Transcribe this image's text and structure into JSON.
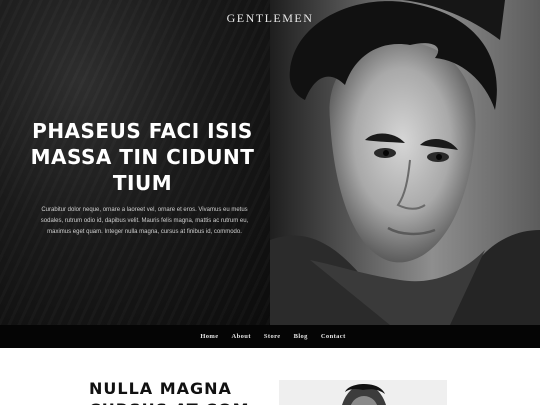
{
  "brand": {
    "name": "GENTLEMEN"
  },
  "hero": {
    "headline": "PHASEUS FACI ISIS MASSA TIN CIDUNT TIUM",
    "body": "Curabitur dolor neque, ornare a laoreet vel, ornare et eros. Vivamus eu metus sodales, rutrum odio id, dapibus velit. Mauris felis magna, mattis ac rutrum eu, maximus eget quam. Integer nulla magna, cursus at finibus id, commodo."
  },
  "nav": {
    "items": [
      {
        "label": "Home"
      },
      {
        "label": "About"
      },
      {
        "label": "Store"
      },
      {
        "label": "Blog"
      },
      {
        "label": "Contact"
      }
    ]
  },
  "section": {
    "title": "NULLA MAGNA CURSUS AT COM"
  },
  "colors": {
    "hero_bg": "#141414",
    "nav_bg": "#050505",
    "text_light": "#ffffff"
  }
}
